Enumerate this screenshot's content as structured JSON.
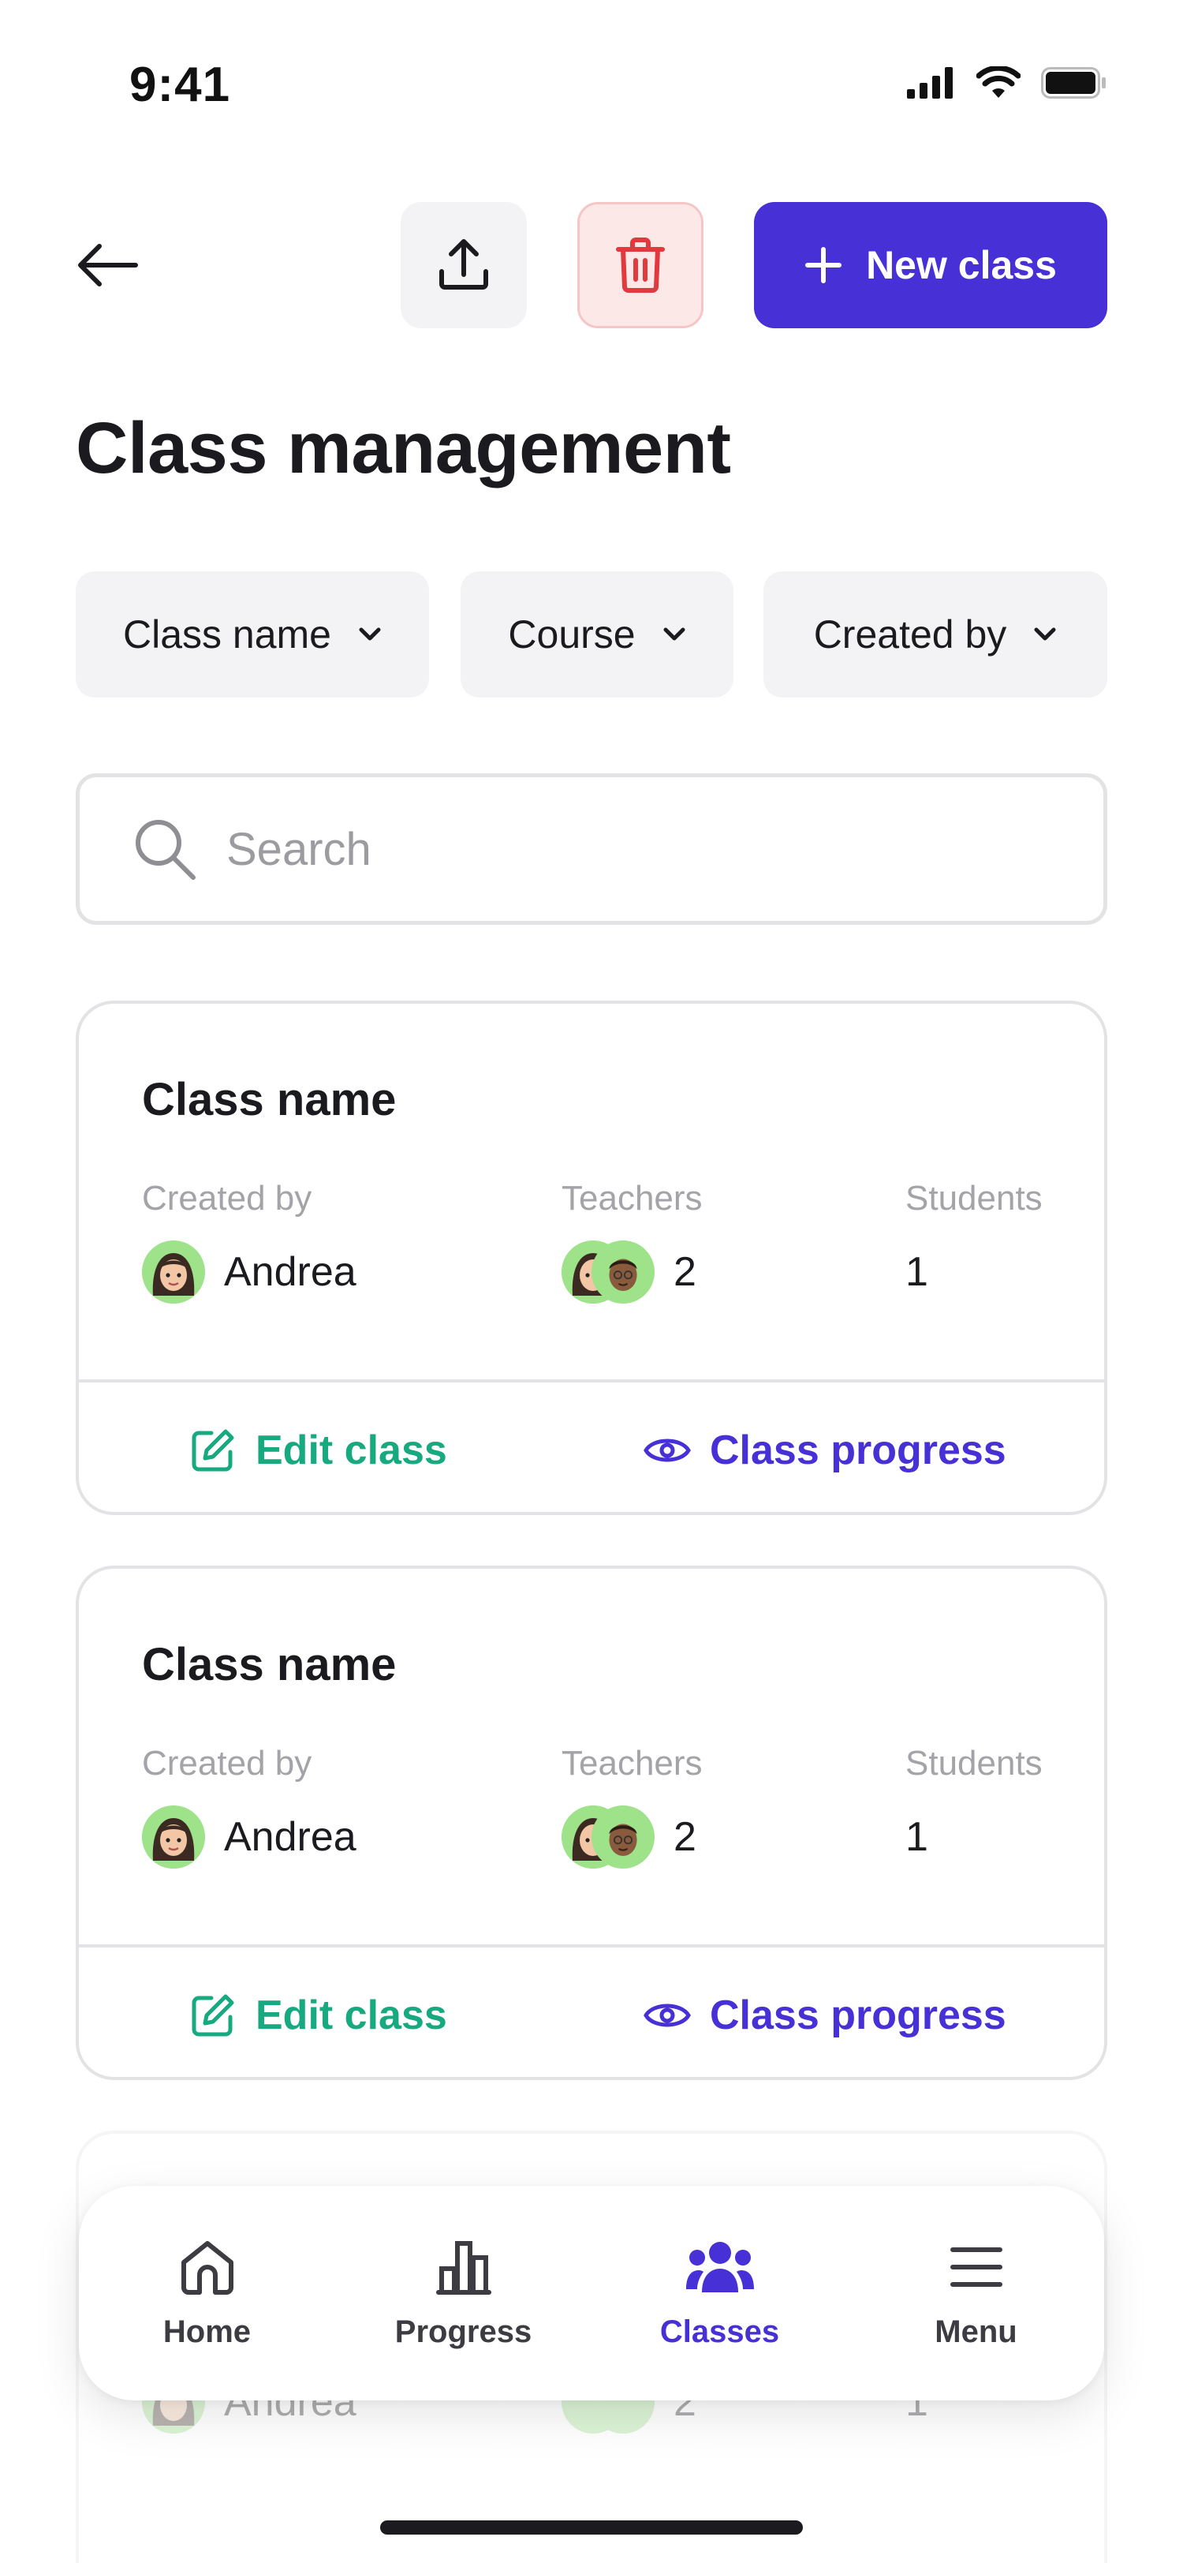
{
  "status_bar": {
    "time": "9:41"
  },
  "header": {
    "new_class_label": "New class",
    "title": "Class management"
  },
  "filters": [
    {
      "label": "Class name"
    },
    {
      "label": "Course"
    },
    {
      "label": "Created by"
    }
  ],
  "search": {
    "placeholder": "Search",
    "value": ""
  },
  "cards": [
    {
      "title": "Class name",
      "created_by_label": "Created by",
      "teachers_label": "Teachers",
      "students_label": "Students",
      "creator_name": "Andrea",
      "teachers_count": "2",
      "students_count": "1",
      "edit_label": "Edit class",
      "progress_label": "Class progress"
    },
    {
      "title": "Class name",
      "created_by_label": "Created by",
      "teachers_label": "Teachers",
      "students_label": "Students",
      "creator_name": "Andrea",
      "teachers_count": "2",
      "students_count": "1",
      "edit_label": "Edit class",
      "progress_label": "Class progress"
    },
    {
      "creator_name": "Andrea",
      "teachers_count": "2",
      "students_count": "1"
    }
  ],
  "nav": [
    {
      "label": "Home",
      "icon": "home-icon"
    },
    {
      "label": "Progress",
      "icon": "bar-chart-icon"
    },
    {
      "label": "Classes",
      "icon": "people-icon",
      "active": true
    },
    {
      "label": "Menu",
      "icon": "hamburger-menu-icon"
    }
  ],
  "colors": {
    "primary": "#4630d6",
    "edit": "#17a97f",
    "danger": "#e0393e",
    "avatar_bg": "#9ee28a"
  }
}
